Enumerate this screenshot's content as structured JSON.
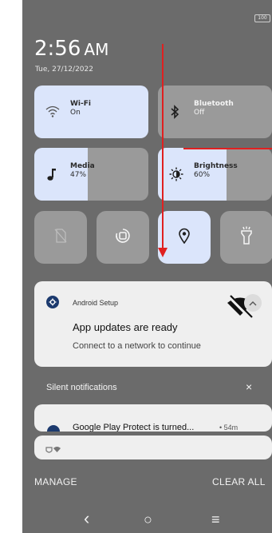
{
  "status_bar": {
    "battery": "100"
  },
  "header": {
    "time": "2:56",
    "ampm": "AM",
    "date": "Tue, 27/12/2022"
  },
  "tiles": {
    "wifi": {
      "title": "Wi-Fi",
      "status": "On"
    },
    "bluetooth": {
      "title": "Bluetooth",
      "status": "Off"
    },
    "media": {
      "title": "Media",
      "status": "47%",
      "level": 0.47
    },
    "brightness": {
      "title": "Brightness",
      "status": "60%",
      "level": 0.6
    }
  },
  "notification": {
    "app": "Android Setup",
    "title": "App updates are ready",
    "body": "Connect to a network to continue"
  },
  "silent": {
    "label": "Silent notifications",
    "close_icon": "×"
  },
  "notification2": {
    "title": "Google Play Protect is turned...",
    "time": "• 54m"
  },
  "actions": {
    "manage": "MANAGE",
    "clear_all": "CLEAR ALL"
  },
  "nav": {
    "back": "‹",
    "home": "○",
    "recents": "≡"
  },
  "colors": {
    "panel": "#6b6b6b",
    "tile_active": "#dbe5fb",
    "tile_inactive": "#9a9a9a",
    "annotation": "#e02020"
  }
}
